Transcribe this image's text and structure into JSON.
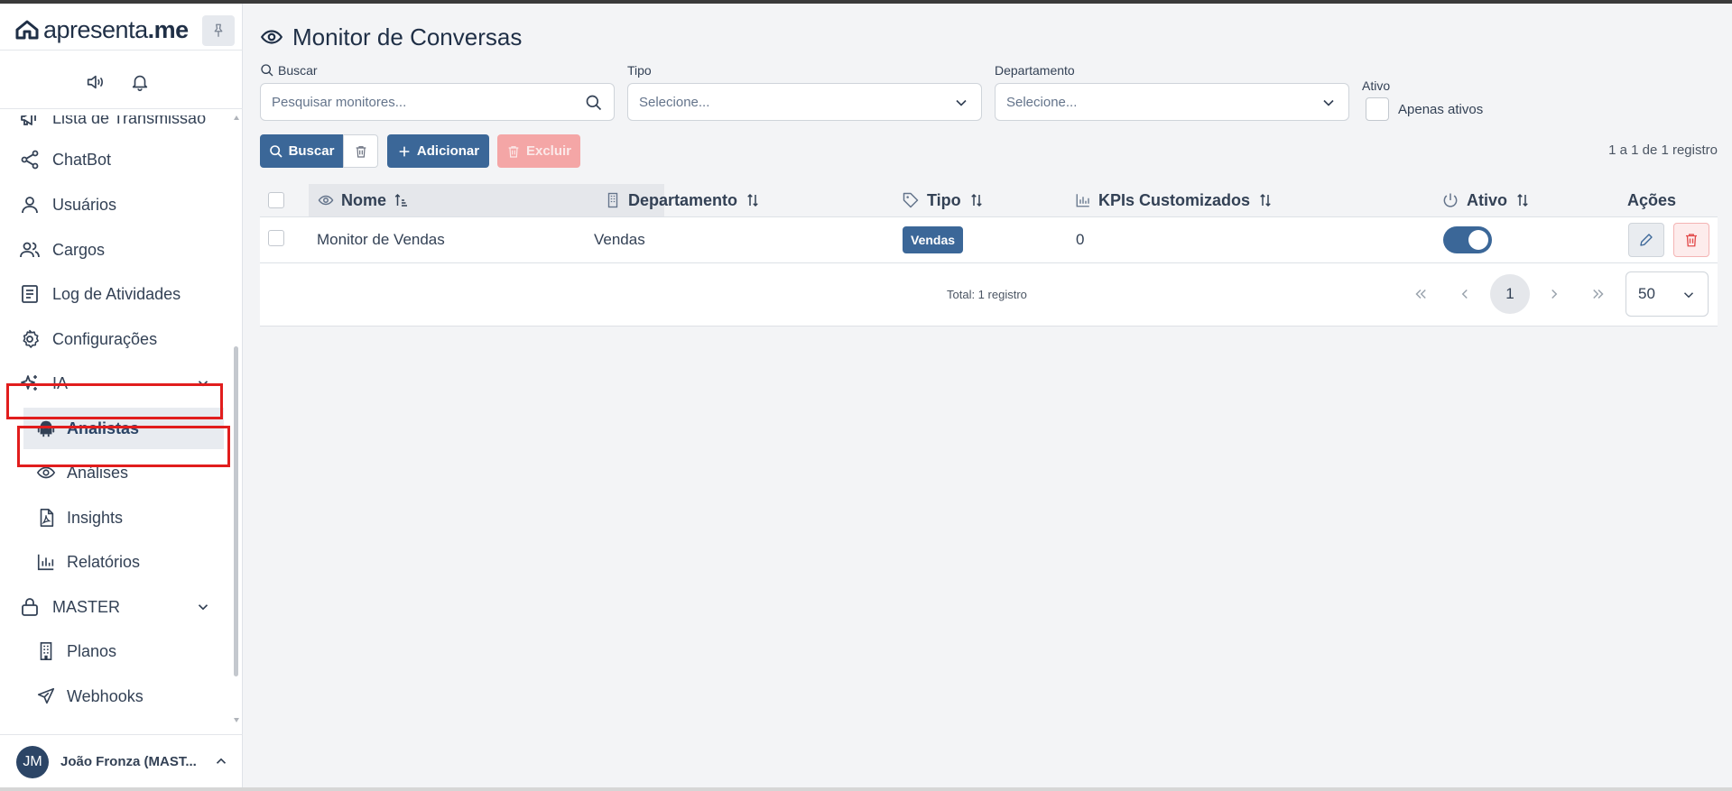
{
  "brand": {
    "name_light": "apresenta",
    "name_bold": ".me"
  },
  "sidebar": {
    "items": [
      {
        "label": "Lista de Transmissão",
        "icon": "megaphone-icon"
      },
      {
        "label": "ChatBot",
        "icon": "share-icon"
      },
      {
        "label": "Usuários",
        "icon": "user-icon"
      },
      {
        "label": "Cargos",
        "icon": "users-icon"
      },
      {
        "label": "Log de Atividades",
        "icon": "document-icon"
      },
      {
        "label": "Configurações",
        "icon": "gear-icon"
      },
      {
        "label": "IA",
        "icon": "sparkles-icon",
        "expanded": true
      },
      {
        "label": "Analistas",
        "icon": "robot-icon",
        "active": true
      },
      {
        "label": "Análises",
        "icon": "eye-icon"
      },
      {
        "label": "Insights",
        "icon": "file-pdf-icon"
      },
      {
        "label": "Relatórios",
        "icon": "bar-chart-icon"
      },
      {
        "label": "MASTER",
        "icon": "lock-icon",
        "expanded": true
      },
      {
        "label": "Planos",
        "icon": "building-icon"
      },
      {
        "label": "Webhooks",
        "icon": "send-icon"
      }
    ]
  },
  "user": {
    "initials": "JM",
    "name": "João Fronza (MAST..."
  },
  "page": {
    "title": "Monitor de Conversas"
  },
  "filters": {
    "search_label": "Buscar",
    "search_placeholder": "Pesquisar monitores...",
    "tipo_label": "Tipo",
    "tipo_value": "Selecione...",
    "departamento_label": "Departamento",
    "departamento_value": "Selecione...",
    "ativo_label": "Ativo",
    "ativo_checkbox_label": "Apenas ativos"
  },
  "toolbar": {
    "buscar_label": "Buscar",
    "adicionar_label": "Adicionar",
    "excluir_label": "Excluir",
    "count_text": "1 a 1 de 1 registro"
  },
  "table": {
    "columns": [
      "Nome",
      "Departamento",
      "Tipo",
      "KPIs Customizados",
      "Ativo",
      "Ações"
    ],
    "rows": [
      {
        "nome": "Monitor de Vendas",
        "departamento": "Vendas",
        "tipo": "Vendas",
        "kpis": "0",
        "ativo": true
      }
    ],
    "total_text": "Total: 1 registro",
    "current_page": "1",
    "page_size": "50"
  },
  "colors": {
    "primary": "#3b6798",
    "danger_light": "#f4a6a6",
    "highlight": "#e11d1d",
    "sidebar_bg": "#ffffff",
    "main_bg": "#f3f4f6"
  }
}
